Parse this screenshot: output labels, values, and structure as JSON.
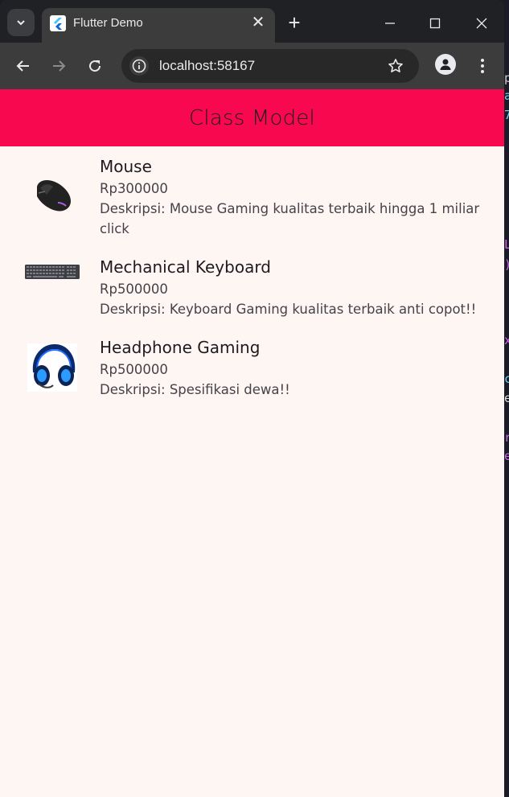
{
  "browser": {
    "tab_title": "Flutter Demo",
    "url": "localhost:58167"
  },
  "app": {
    "title": "Class Model",
    "colors": {
      "appbar": "#f8084f",
      "background": "#fef6f3"
    },
    "items": [
      {
        "name": "Mouse",
        "price": "Rp300000",
        "description": "Deskripsi: Mouse Gaming kualitas terbaik hingga 1 miliar click",
        "image": "gaming-mouse"
      },
      {
        "name": "Mechanical Keyboard",
        "price": "Rp500000",
        "description": "Deskripsi: Keyboard Gaming kualitas terbaik anti copot!!",
        "image": "mechanical-keyboard"
      },
      {
        "name": "Headphone Gaming",
        "price": "Rp500000",
        "description": "Deskripsi: Spesifikasi dewa!!",
        "image": "gaming-headphone"
      }
    ]
  }
}
